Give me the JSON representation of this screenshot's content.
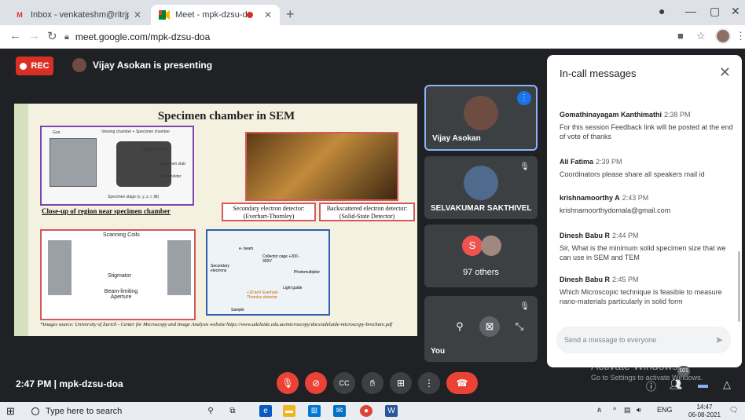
{
  "browser": {
    "tabs": [
      {
        "title": "Inbox - venkateshm@ritrjpm.ac.i",
        "favicon": "gmail-icon",
        "active": false
      },
      {
        "title": "Meet - mpk-dzsu-doa",
        "favicon": "meet-icon",
        "active": true
      }
    ],
    "url": "meet.google.com/mpk-dzsu-doa"
  },
  "meet": {
    "rec_label": "REC",
    "presenting_text": "Vijay Asokan is presenting",
    "slide": {
      "title": "Specimen chamber in SEM",
      "sem_caption": "Close-up of region near specimen chamber",
      "sem_labels": [
        "Gun",
        "Viewing chamber + Specimen chamber",
        "Objective lens",
        "Specimen stub",
        "Stub holder",
        "Specimen stage (x, y, z, r, tilt)"
      ],
      "detector1": "Secondary electron detector: (Everhart-Thornley)",
      "detector2": "Backscattered electron detector: (Solid-State Detector)",
      "coil_labels": [
        "Scanning Coils",
        "Stigmator",
        "Beam-limiting Aperture"
      ],
      "diagram_labels": [
        "e- beam",
        "Collector cage +200 - 300V",
        "Secondary electrons",
        "Photomultiplier",
        "Light guide",
        "+10 keV Everhart-Thornley detector",
        "Sample"
      ],
      "footnote": "*Images source: University of Zurich - Center for Microscopy and Image Analysis website   https://www.adelaide.edu.au/microscopy/docs/adelaide-microscopy-brochure.pdf"
    },
    "participants": [
      {
        "name": "Vijay Asokan"
      },
      {
        "name": "SELVAKUMAR SAKTHIVEL"
      },
      {
        "name": "97 others",
        "initial": "S"
      },
      {
        "name": "You"
      }
    ],
    "chat": {
      "title": "In-call messages",
      "messages": [
        {
          "sender": "Gomathinayagam Kanthimathi",
          "time": "2:38 PM",
          "text": "For this session Feedback link will be posted at the end of vote of thanks"
        },
        {
          "sender": "Ali Fatima",
          "time": "2:39 PM",
          "text": "Coordinators  please share all speakers mail id"
        },
        {
          "sender": "krishnamoorthy A",
          "time": "2:43 PM",
          "text": "krishnamoorthydomala@gmail.com"
        },
        {
          "sender": "Dinesh Babu R",
          "time": "2:44 PM",
          "text": "Sir, What is the minimum solid specimen size that we can use in SEM and TEM"
        },
        {
          "sender": "Dinesh Babu R",
          "time": "2:45 PM",
          "text": "Which Microscopic technique is feasible to measure nano-materials particularly in solid form"
        }
      ],
      "input_placeholder": "Send a message to everyone"
    },
    "meeting_info": "2:47 PM  |  mpk-dzsu-doa",
    "watermark": {
      "line1": "Activate Windows",
      "line2": "Go to Settings to activate Windows."
    },
    "participant_badge": "101"
  },
  "taskbar": {
    "search_placeholder": "Type here to search",
    "lang": "ENG",
    "time": "14:47",
    "date": "06-08-2021"
  }
}
